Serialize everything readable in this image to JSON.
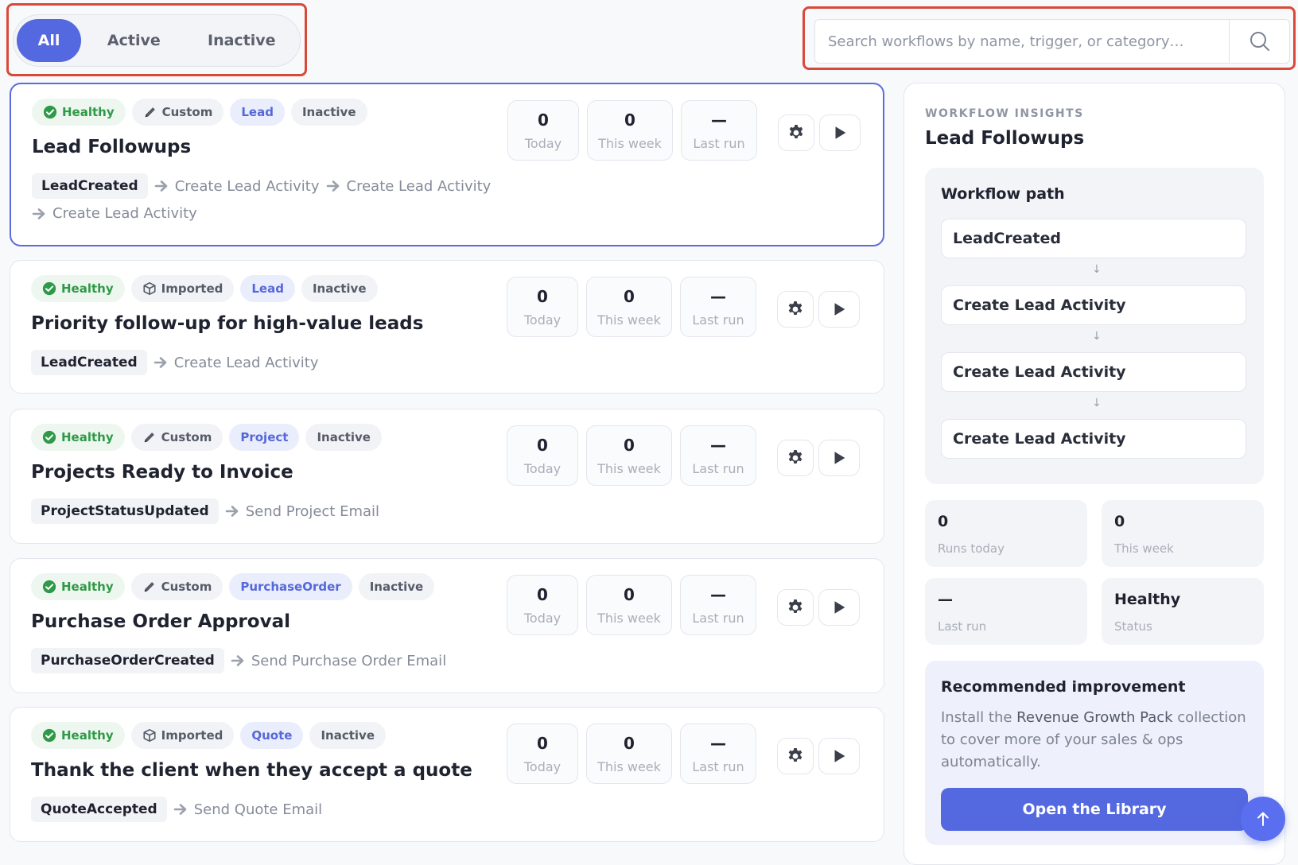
{
  "filter_tabs": [
    {
      "label": "All",
      "selected": true
    },
    {
      "label": "Active",
      "selected": false
    },
    {
      "label": "Inactive",
      "selected": false
    }
  ],
  "search": {
    "placeholder": "Search workflows by name, trigger, or category…",
    "value": ""
  },
  "stat_labels": {
    "today": "Today",
    "week": "This week",
    "last_run": "Last run"
  },
  "workflows": [
    {
      "health": "Healthy",
      "source": "Custom",
      "category": "Lead",
      "state": "Inactive",
      "title": "Lead Followups",
      "trigger": "LeadCreated",
      "steps": [
        "Create Lead Activity",
        "Create Lead Activity",
        "Create Lead Activity"
      ],
      "today": "0",
      "week": "0",
      "last_run": "—",
      "selected": true
    },
    {
      "health": "Healthy",
      "source": "Imported",
      "category": "Lead",
      "state": "Inactive",
      "title": "Priority follow-up for high-value leads",
      "trigger": "LeadCreated",
      "steps": [
        "Create Lead Activity"
      ],
      "today": "0",
      "week": "0",
      "last_run": "—"
    },
    {
      "health": "Healthy",
      "source": "Custom",
      "category": "Project",
      "state": "Inactive",
      "title": "Projects Ready to Invoice",
      "trigger": "ProjectStatusUpdated",
      "steps": [
        "Send Project Email"
      ],
      "today": "0",
      "week": "0",
      "last_run": "—"
    },
    {
      "health": "Healthy",
      "source": "Custom",
      "category": "PurchaseOrder",
      "state": "Inactive",
      "title": "Purchase Order Approval",
      "trigger": "PurchaseOrderCreated",
      "steps": [
        "Send Purchase Order Email"
      ],
      "today": "0",
      "week": "0",
      "last_run": "—"
    },
    {
      "health": "Healthy",
      "source": "Imported",
      "category": "Quote",
      "state": "Inactive",
      "title": "Thank the client when they accept a quote",
      "trigger": "QuoteAccepted",
      "steps": [
        "Send Quote Email"
      ],
      "today": "0",
      "week": "0",
      "last_run": "—"
    }
  ],
  "insights": {
    "eyebrow": "WORKFLOW INSIGHTS",
    "title": "Lead Followups",
    "path_heading": "Workflow path",
    "path_nodes": [
      "LeadCreated",
      "Create Lead Activity",
      "Create Lead Activity",
      "Create Lead Activity"
    ],
    "path_arrow": "↓",
    "stats": [
      {
        "value": "0",
        "label": "Runs today"
      },
      {
        "value": "0",
        "label": "This week"
      },
      {
        "value": "—",
        "label": "Last run"
      },
      {
        "value": "Healthy",
        "label": "Status"
      }
    ],
    "recommendation": {
      "heading": "Recommended improvement",
      "text_before": "Install the ",
      "text_highlight": "Revenue Growth Pack",
      "text_after": " collection to cover more of your sales & ops automatically.",
      "button": "Open the Library"
    }
  },
  "colors": {
    "accent": "#5468e0",
    "healthy": "#2e9a47",
    "highlight_box": "#d9493a"
  },
  "icons": {
    "health": "check-circle-icon",
    "custom": "pencil-icon",
    "imported": "package-icon",
    "settings": "gear-icon",
    "run": "play-icon",
    "search": "search-icon",
    "scroll_top": "arrow-up-icon"
  }
}
